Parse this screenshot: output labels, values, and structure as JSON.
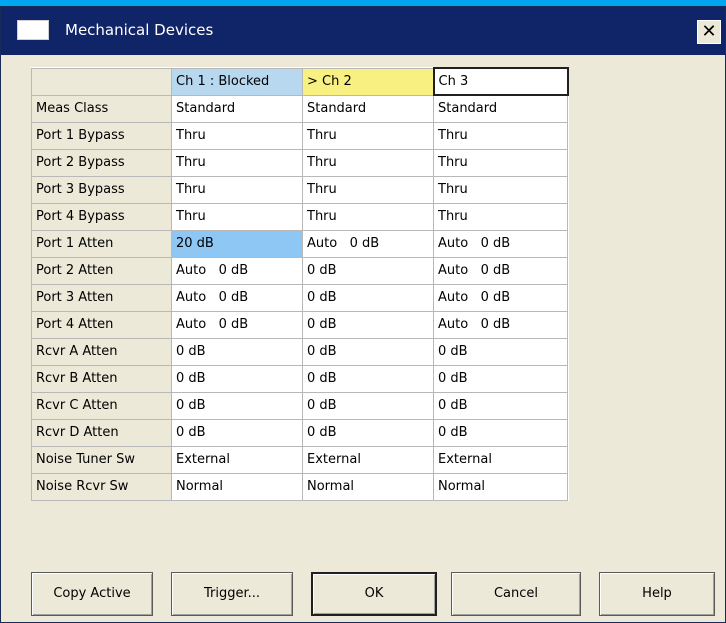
{
  "window": {
    "title": "Mechanical Devices",
    "close_glyph": "✕",
    "icon": "window-icon",
    "colors": {
      "titlebar": "#102468",
      "dialog": "#ece9d8",
      "selected_cell": "#8ec6f4",
      "active_channel": "#f8f080",
      "blocked_channel": "#b8d8f0"
    }
  },
  "grid": {
    "columns": [
      "Ch 1 : Blocked",
      "> Ch 2",
      "Ch 3"
    ],
    "rows": [
      {
        "label": "Meas Class",
        "cells": [
          "Standard",
          "Standard",
          "Standard"
        ]
      },
      {
        "label": "Port 1 Bypass",
        "cells": [
          "Thru",
          "Thru",
          "Thru"
        ]
      },
      {
        "label": "Port 2 Bypass",
        "cells": [
          "Thru",
          "Thru",
          "Thru"
        ]
      },
      {
        "label": "Port 3 Bypass",
        "cells": [
          "Thru",
          "Thru",
          "Thru"
        ]
      },
      {
        "label": "Port 4 Bypass",
        "cells": [
          "Thru",
          "Thru",
          "Thru"
        ]
      },
      {
        "label": "Port 1 Atten",
        "cells": [
          "20 dB",
          "Auto   0 dB",
          "Auto   0 dB"
        ]
      },
      {
        "label": "Port 2 Atten",
        "cells": [
          "Auto   0 dB",
          "0 dB",
          "Auto   0 dB"
        ]
      },
      {
        "label": "Port 3 Atten",
        "cells": [
          "Auto   0 dB",
          "0 dB",
          "Auto   0 dB"
        ]
      },
      {
        "label": "Port 4 Atten",
        "cells": [
          "Auto   0 dB",
          "0 dB",
          "Auto   0 dB"
        ]
      },
      {
        "label": "Rcvr A Atten",
        "cells": [
          "0 dB",
          "0 dB",
          "0 dB"
        ]
      },
      {
        "label": "Rcvr B Atten",
        "cells": [
          "0 dB",
          "0 dB",
          "0 dB"
        ]
      },
      {
        "label": "Rcvr C Atten",
        "cells": [
          "0 dB",
          "0 dB",
          "0 dB"
        ]
      },
      {
        "label": "Rcvr D Atten",
        "cells": [
          "0 dB",
          "0 dB",
          "0 dB"
        ]
      },
      {
        "label": "Noise Tuner Sw",
        "cells": [
          "External",
          "External",
          "External"
        ]
      },
      {
        "label": "Noise Rcvr Sw",
        "cells": [
          "Normal",
          "Normal",
          "Normal"
        ]
      }
    ]
  },
  "buttons": {
    "copy_active": "Copy Active",
    "trigger": "Trigger...",
    "ok": "OK",
    "cancel": "Cancel",
    "help": "Help"
  }
}
